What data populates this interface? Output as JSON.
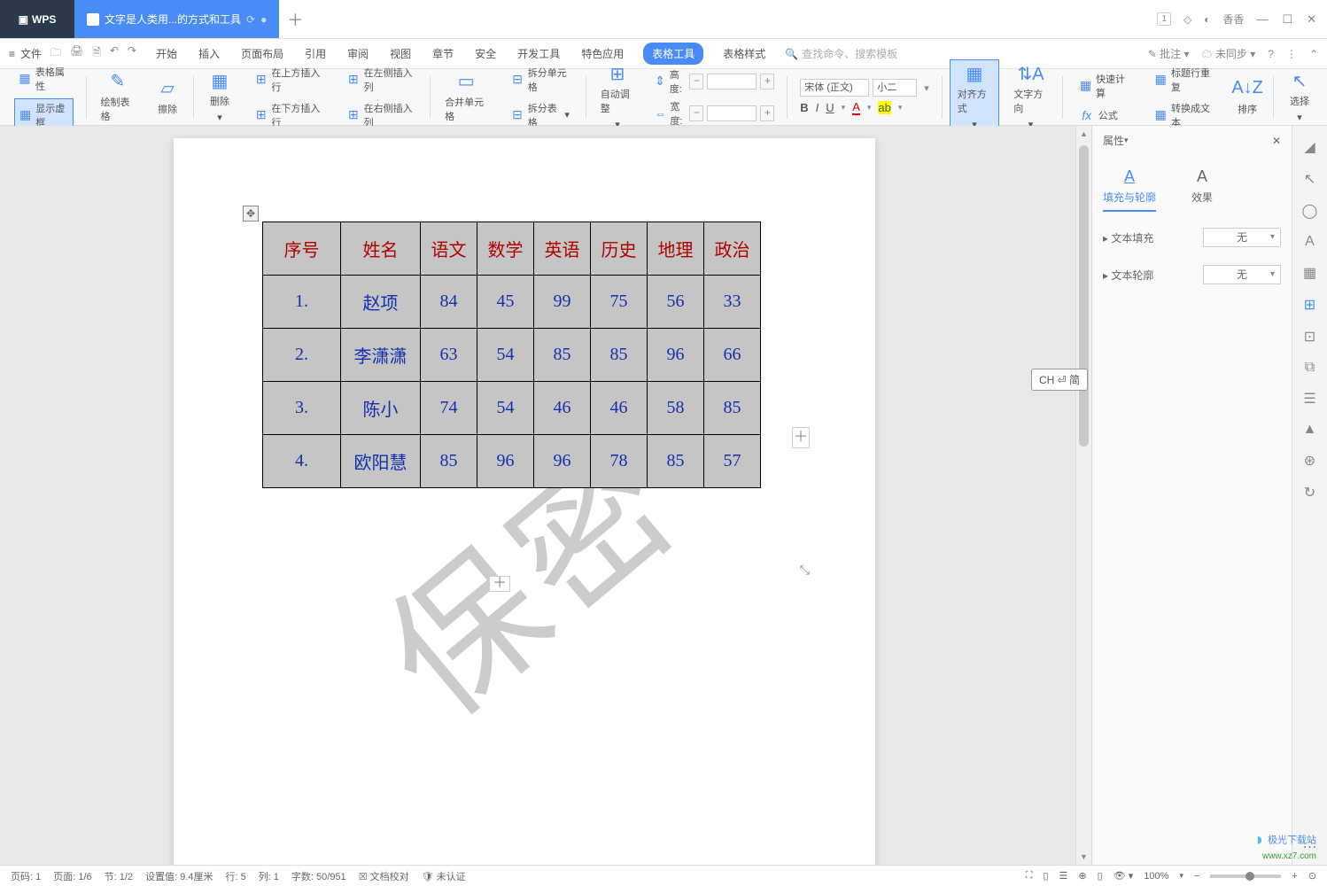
{
  "titlebar": {
    "logo": "WPS",
    "tab_label": "文字是人类用...的方式和工具",
    "badge": "1",
    "user": "香香"
  },
  "menubar": {
    "file": "文件",
    "tabs": [
      "开始",
      "插入",
      "页面布局",
      "引用",
      "审阅",
      "视图",
      "章节",
      "安全",
      "开发工具",
      "特色应用",
      "表格工具",
      "表格样式"
    ],
    "active_tab": "表格工具",
    "search_placeholder": "查找命令、搜索模板",
    "right": {
      "comment": "批注",
      "sync": "未同步"
    }
  },
  "ribbon": {
    "table_props": "表格属性",
    "show_grid": "显示虚框",
    "draw_table": "绘制表格",
    "eraser": "擦除",
    "delete": "删除",
    "insert_above": "在上方插入行",
    "insert_below": "在下方插入行",
    "insert_left": "在左侧插入列",
    "insert_right": "在右侧插入列",
    "merge": "合并单元格",
    "split_cell": "拆分单元格",
    "split_table": "拆分表格",
    "autofit": "自动调整",
    "height_label": "高度:",
    "width_label": "宽度:",
    "height_value": "",
    "width_value": "",
    "font_name": "宋体 (正文)",
    "font_size": "小二",
    "align": "对齐方式",
    "text_dir": "文字方向",
    "quick_calc": "快速计算",
    "title_repeat": "标题行重复",
    "formula": "公式",
    "to_text": "转换成文本",
    "sort": "排序",
    "select": "选择"
  },
  "table": {
    "headers": [
      "序号",
      "姓名",
      "语文",
      "数学",
      "英语",
      "历史",
      "地理",
      "政治"
    ],
    "rows": [
      {
        "seq": "1.",
        "name": "赵项",
        "vals": [
          "84",
          "45",
          "99",
          "75",
          "56",
          "33"
        ]
      },
      {
        "seq": "2.",
        "name": "李潇潇",
        "vals": [
          "63",
          "54",
          "85",
          "85",
          "96",
          "66"
        ]
      },
      {
        "seq": "3.",
        "name": "陈小",
        "vals": [
          "74",
          "54",
          "46",
          "46",
          "58",
          "85"
        ]
      },
      {
        "seq": "4.",
        "name": "欧阳慧",
        "vals": [
          "85",
          "96",
          "96",
          "78",
          "85",
          "57"
        ]
      }
    ]
  },
  "watermark": "保密",
  "ime_tip": "CH ⏎ 简",
  "props": {
    "title": "属性",
    "tab_fill": "填充与轮廓",
    "tab_effect": "效果",
    "text_fill": "文本填充",
    "text_outline": "文本轮廓",
    "none": "无"
  },
  "status": {
    "page_no": "页码: 1",
    "page": "页面: 1/6",
    "section": "节: 1/2",
    "position": "设置值: 9.4厘米",
    "row": "行: 5",
    "col": "列: 1",
    "words": "字数: 50/951",
    "proof": "文档校对",
    "verify": "未认证",
    "zoom": "100%"
  },
  "logo": {
    "line1": "极光下载站",
    "line2": "www.xz7.com"
  }
}
